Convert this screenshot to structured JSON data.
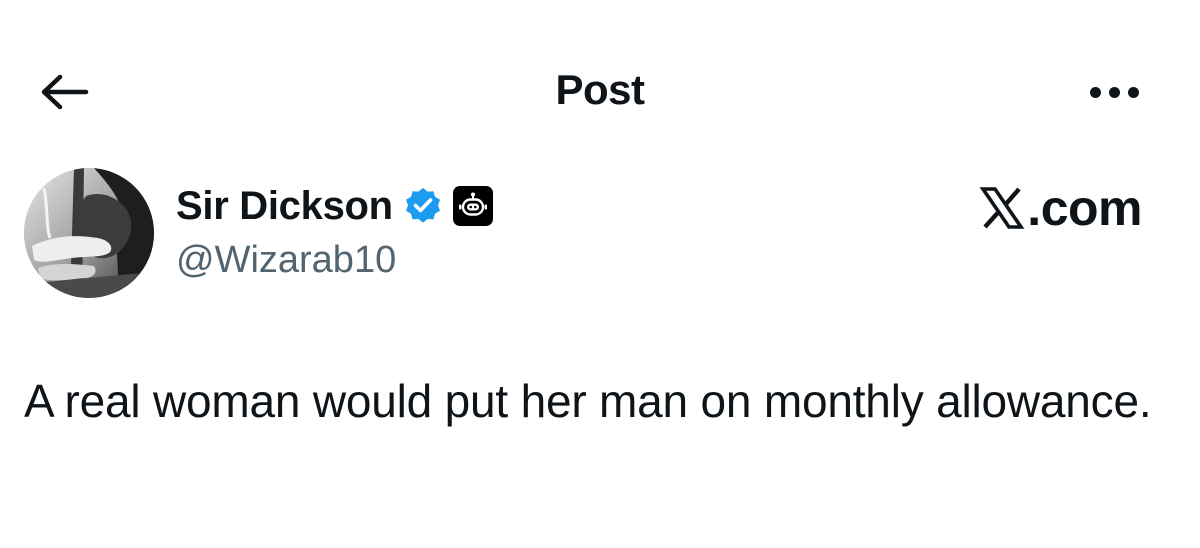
{
  "header": {
    "back_icon": "arrow-left-icon",
    "title": "Post",
    "more_icon": "ellipsis-horizontal-icon"
  },
  "post": {
    "author": {
      "name": "Sir Dickson",
      "handle": "@Wizarab10",
      "verified_icon": "verified-badge-icon",
      "verified_color": "#1d9bf0",
      "affiliation_icon": "robot-badge-icon"
    },
    "watermark": ".com",
    "watermark_logo": "x-logo-icon",
    "text": "A real woman would put her man on monthly allowance."
  },
  "colors": {
    "text_primary": "#0f1419",
    "text_secondary": "#536471",
    "accent": "#1d9bf0",
    "background": "#ffffff"
  }
}
